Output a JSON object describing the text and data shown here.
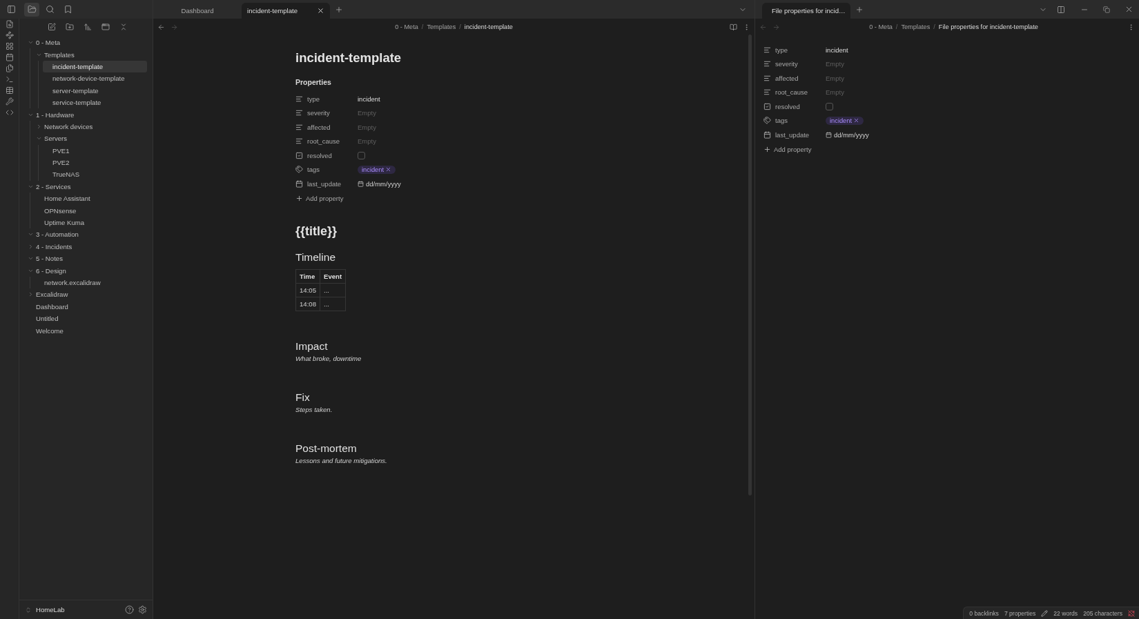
{
  "tab_bar": {
    "left_tabs": [
      {
        "title": "Dashboard",
        "selected": false
      },
      {
        "title": "incident-template",
        "selected": true
      }
    ],
    "right_tabs": [
      {
        "title": "File properties for incid…",
        "selected": true
      }
    ]
  },
  "sidebar": {
    "tree": [
      {
        "name": "0 - Meta",
        "kind": "folder",
        "expanded": true,
        "children": [
          {
            "name": "Templates",
            "kind": "folder",
            "expanded": true,
            "children": [
              {
                "name": "incident-template",
                "kind": "file",
                "selected": true
              },
              {
                "name": "network-device-template",
                "kind": "file",
                "selected": false
              },
              {
                "name": "server-template",
                "kind": "file",
                "selected": false
              },
              {
                "name": "service-template",
                "kind": "file",
                "selected": false
              }
            ]
          }
        ]
      },
      {
        "name": "1 - Hardware",
        "kind": "folder",
        "expanded": true,
        "children": [
          {
            "name": "Network devices",
            "kind": "folder",
            "expanded": false
          },
          {
            "name": "Servers",
            "kind": "folder",
            "expanded": true,
            "children": [
              {
                "name": "PVE1",
                "kind": "file",
                "selected": false
              },
              {
                "name": "PVE2",
                "kind": "file",
                "selected": false
              },
              {
                "name": "TrueNAS",
                "kind": "file",
                "selected": false
              }
            ]
          }
        ]
      },
      {
        "name": "2 - Services",
        "kind": "folder",
        "expanded": true,
        "children": [
          {
            "name": "Home Assistant",
            "kind": "file",
            "selected": false
          },
          {
            "name": "OPNsense",
            "kind": "file",
            "selected": false
          },
          {
            "name": "Uptime Kuma",
            "kind": "file",
            "selected": false
          }
        ]
      },
      {
        "name": "3 - Automation",
        "kind": "folder",
        "expanded": true
      },
      {
        "name": "4 - Incidents",
        "kind": "folder",
        "expanded": false
      },
      {
        "name": "5 - Notes",
        "kind": "folder",
        "expanded": true
      },
      {
        "name": "6 - Design",
        "kind": "folder",
        "expanded": true,
        "children": [
          {
            "name": "network.excalidraw",
            "kind": "file",
            "selected": false
          }
        ]
      },
      {
        "name": "Excalidraw",
        "kind": "folder",
        "expanded": false
      },
      {
        "name": "Dashboard",
        "kind": "file",
        "selected": false
      },
      {
        "name": "Untitled",
        "kind": "file",
        "selected": false
      },
      {
        "name": "Welcome",
        "kind": "file",
        "selected": false
      }
    ],
    "vault": "HomeLab"
  },
  "editor": {
    "breadcrumb": {
      "items": [
        "0 - Meta",
        "Templates",
        "incident-template"
      ],
      "separator": "/"
    },
    "title": "incident-template",
    "properties_heading": "Properties",
    "properties": [
      {
        "key": "type",
        "kind": "text",
        "value": "incident"
      },
      {
        "key": "severity",
        "kind": "text",
        "placeholder": "Empty"
      },
      {
        "key": "affected",
        "kind": "text",
        "placeholder": "Empty"
      },
      {
        "key": "root_cause",
        "kind": "text",
        "placeholder": "Empty"
      },
      {
        "key": "resolved",
        "kind": "checkbox",
        "checked": false
      },
      {
        "key": "tags",
        "kind": "tags",
        "tags": [
          "incident"
        ]
      },
      {
        "key": "last_update",
        "kind": "date",
        "placeholder": "dd/mm/yyyy"
      }
    ],
    "add_property": "Add property",
    "blocks": [
      {
        "kind": "h1",
        "text": "{{title}}"
      },
      {
        "kind": "h2",
        "text": "Timeline"
      },
      {
        "kind": "table",
        "columns": [
          "Time",
          "Event"
        ],
        "rows": [
          [
            "14:05",
            "..."
          ],
          [
            "14:08",
            "..."
          ]
        ]
      },
      {
        "kind": "h2",
        "text": "Impact"
      },
      {
        "kind": "para",
        "text": "What broke, downtime"
      },
      {
        "kind": "h2",
        "text": "Fix"
      },
      {
        "kind": "para",
        "text": "Steps taken."
      },
      {
        "kind": "h2",
        "text": "Post-mortem"
      },
      {
        "kind": "para",
        "text": "Lessons and future mitigations."
      }
    ]
  },
  "properties_pane": {
    "breadcrumb": {
      "items": [
        "0 - Meta",
        "Templates",
        "File properties for incident-template"
      ],
      "separator": "/"
    },
    "properties": [
      {
        "key": "type",
        "kind": "text",
        "value": "incident"
      },
      {
        "key": "severity",
        "kind": "text",
        "placeholder": "Empty"
      },
      {
        "key": "affected",
        "kind": "text",
        "placeholder": "Empty"
      },
      {
        "key": "root_cause",
        "kind": "text",
        "placeholder": "Empty"
      },
      {
        "key": "resolved",
        "kind": "checkbox",
        "checked": false
      },
      {
        "key": "tags",
        "kind": "tags",
        "tags": [
          "incident"
        ]
      },
      {
        "key": "last_update",
        "kind": "date",
        "placeholder": "dd/mm/yyyy"
      }
    ],
    "add_property": "Add property"
  },
  "status_bar": {
    "backlinks": "0 backlinks",
    "properties": "7 properties",
    "words": "22 words",
    "characters": "205 characters"
  }
}
